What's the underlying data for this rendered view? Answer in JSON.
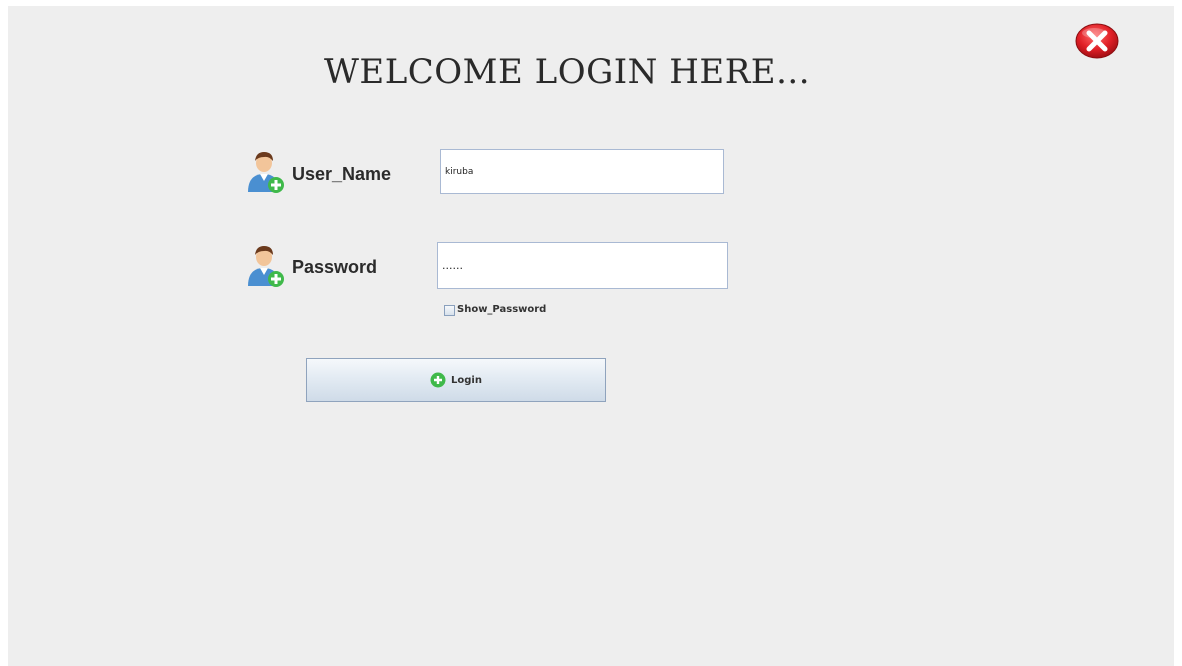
{
  "title": "WELCOME LOGIN HERE...",
  "username": {
    "label": "User_Name",
    "value": "kiruba",
    "icon": "user-add-icon"
  },
  "password": {
    "label": "Password",
    "value": "......",
    "icon": "user-add-icon"
  },
  "show_password": {
    "label": "Show_Password",
    "checked": false
  },
  "login": {
    "label": "Login",
    "icon": "green-plus-icon"
  },
  "close": {
    "icon": "red-close-icon"
  },
  "colors": {
    "background": "#eeeeee",
    "close_red": "#e01f26",
    "plus_green": "#3fb94a",
    "input_border": "#a9b9d3"
  }
}
